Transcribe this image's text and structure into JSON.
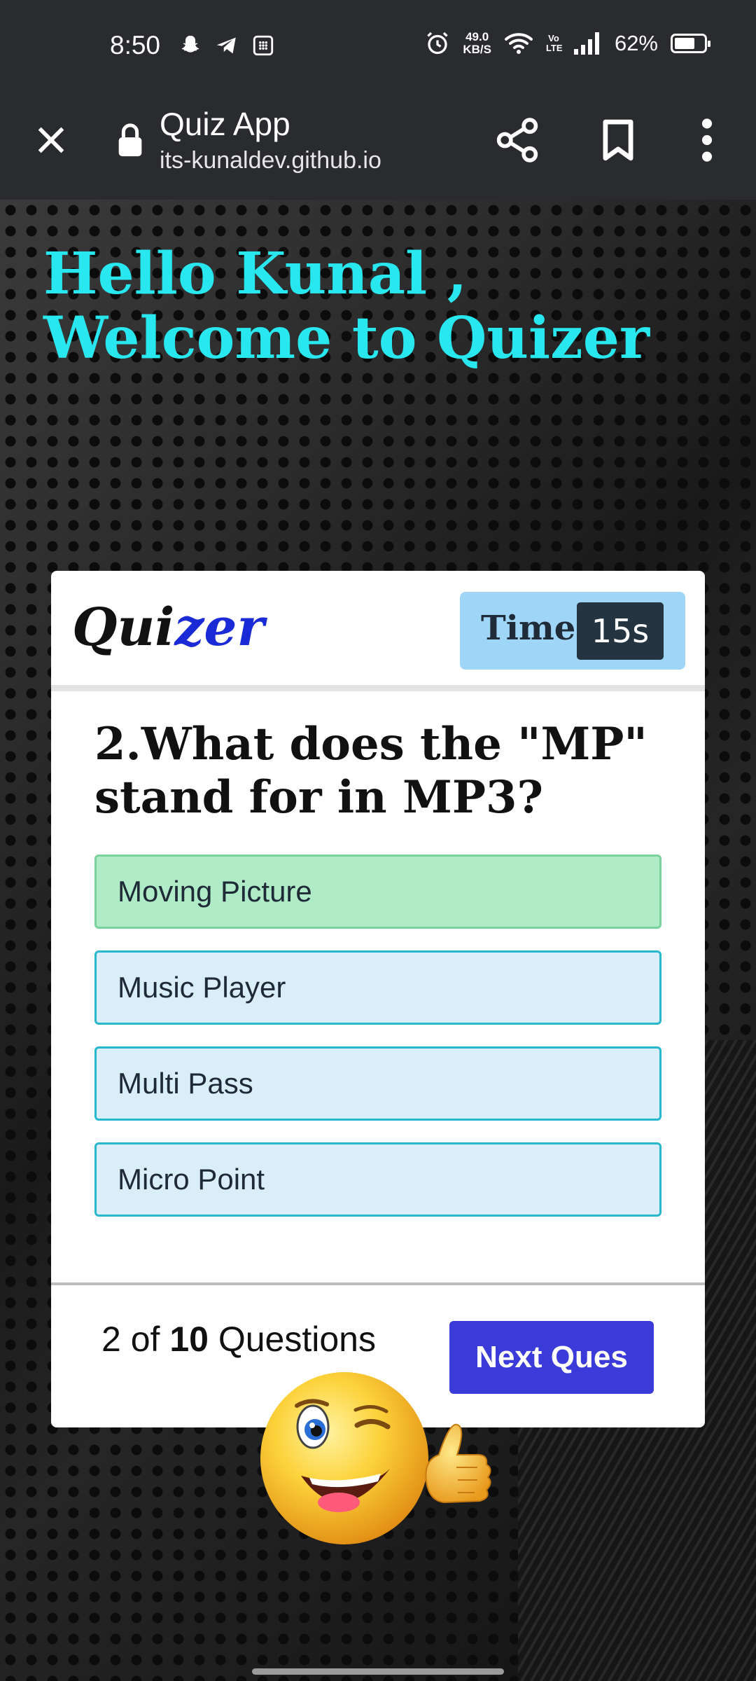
{
  "status_bar": {
    "time": "8:50",
    "net_speed_value": "49.0",
    "net_speed_unit": "KB/S",
    "volte": "Vo LTE",
    "battery": "62%",
    "left_icons": [
      "snapchat-icon",
      "telegram-icon",
      "calculator-icon"
    ],
    "right_icons": [
      "alarm-icon",
      "wifi-icon",
      "signal-icon",
      "battery-icon"
    ]
  },
  "browser": {
    "title": "Quiz App",
    "url": "its-kunaldev.github.io"
  },
  "page": {
    "welcome": "Hello Kunal , Welcome to Quizer"
  },
  "quiz": {
    "logo_part1": "Qui",
    "logo_part2": "zer",
    "timer_label": "Time",
    "timer_value": "15s",
    "question": "2.What does the \"MP\" stand for in MP3?",
    "options": [
      {
        "label": "Moving Picture",
        "state": "correct"
      },
      {
        "label": "Music Player",
        "state": "default"
      },
      {
        "label": "Multi Pass",
        "state": "default"
      },
      {
        "label": "Micro Point",
        "state": "default"
      }
    ],
    "counter_current": "2",
    "counter_of": "of",
    "counter_total": "10",
    "counter_suffix": "Questions",
    "next_button": "Next Ques"
  },
  "colors": {
    "welcome_text": "#28e7ee",
    "correct_option": "#b0ebc8",
    "default_option": "#daeef9",
    "next_button": "#3a3bd9",
    "timer_bg": "#9fd6f7"
  }
}
